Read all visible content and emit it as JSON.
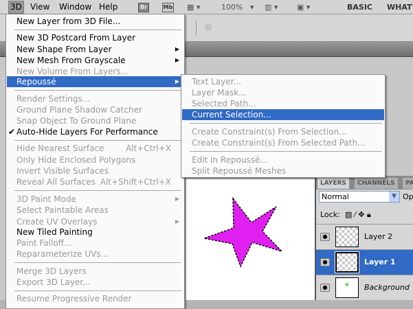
{
  "menubar": {
    "items": [
      "3D",
      "View",
      "Window",
      "Help"
    ],
    "zoom": "100%",
    "br": "Br",
    "mb": "Mb",
    "workspaces": [
      "BASIC",
      "WHAT'S"
    ]
  },
  "menu3d": {
    "items": [
      {
        "label": "New Layer from 3D File...",
        "enabled": true
      },
      {
        "label": "New 3D Postcard From Layer",
        "enabled": true
      },
      {
        "label": "New Shape From Layer",
        "enabled": true,
        "submenu": true
      },
      {
        "label": "New Mesh From Grayscale",
        "enabled": true,
        "submenu": true
      },
      {
        "label": "New Volume From Layers...",
        "enabled": false
      },
      {
        "label": "Repoussé",
        "enabled": true,
        "submenu": true,
        "highlighted": true
      },
      {
        "label": "Render Settings...",
        "enabled": false
      },
      {
        "label": "Ground Plane Shadow Catcher",
        "enabled": false
      },
      {
        "label": "Snap Object To Ground Plane",
        "enabled": false
      },
      {
        "label": "Auto-Hide Layers For Performance",
        "enabled": true,
        "checked": true
      },
      {
        "label": "Hide Nearest Surface",
        "enabled": false,
        "shortcut": "Alt+Ctrl+X"
      },
      {
        "label": "Only Hide Enclosed Polygons",
        "enabled": false
      },
      {
        "label": "Invert Visible Surfaces",
        "enabled": false
      },
      {
        "label": "Reveal All Surfaces",
        "enabled": false,
        "shortcut": "Alt+Shift+Ctrl+X"
      },
      {
        "label": "3D Paint Mode",
        "enabled": false,
        "submenu": true
      },
      {
        "label": "Select Paintable Areas",
        "enabled": false
      },
      {
        "label": "Create UV Overlays",
        "enabled": false,
        "submenu": true
      },
      {
        "label": "New Tiled Painting",
        "enabled": true
      },
      {
        "label": "Paint Falloff...",
        "enabled": false
      },
      {
        "label": "Reparameterize UVs...",
        "enabled": false
      },
      {
        "label": "Merge 3D Layers",
        "enabled": false
      },
      {
        "label": "Export 3D Layer...",
        "enabled": false
      },
      {
        "label": "Resume Progressive Render",
        "enabled": false
      }
    ]
  },
  "repousse": {
    "items": [
      {
        "label": "Text Layer...",
        "enabled": false
      },
      {
        "label": "Layer Mask...",
        "enabled": false
      },
      {
        "label": "Selected Path...",
        "enabled": false
      },
      {
        "label": "Current Selection...",
        "enabled": true,
        "highlighted": true
      },
      {
        "label": "Create Constraint(s) From Selection...",
        "enabled": false
      },
      {
        "label": "Create Constraint(s) From Selected Path...",
        "enabled": false
      },
      {
        "label": "Edit in Repoussé...",
        "enabled": false
      },
      {
        "label": "Split Repoussé Meshes",
        "enabled": false
      }
    ]
  },
  "layers_panel": {
    "tabs": [
      "LAYERS",
      "CHANNELS",
      "PA"
    ],
    "blend_mode": "Normal",
    "opacity_label": "Opa",
    "lock_label": "Lock:",
    "layers": [
      {
        "name": "Layer 2",
        "selected": false
      },
      {
        "name": "Layer 1",
        "selected": true
      },
      {
        "name": "Background",
        "selected": false
      }
    ]
  },
  "colors": {
    "highlight": "#316ac5",
    "star": "#e020f0"
  }
}
